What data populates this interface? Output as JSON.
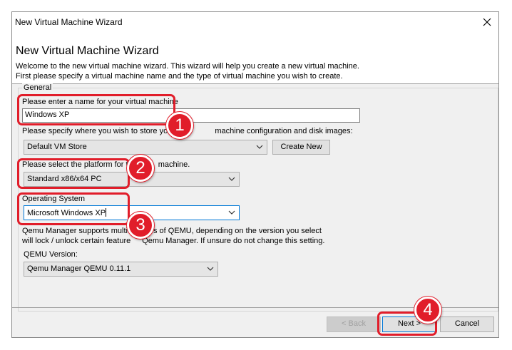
{
  "window": {
    "title": "New Virtual Machine Wizard",
    "close_glyph": "✕"
  },
  "header": {
    "title": "New Virtual Machine Wizard",
    "desc_line1": "Welcome to the new virtual machine wizard.   This wizard will help you create a new virtual machine.",
    "desc_line2": "First please specify a virtual machine name and the type of virtual machine you wish to create."
  },
  "general": {
    "legend": "General",
    "name_label": "Please enter a name for your virtual machine",
    "name_value": "Windows XP",
    "store_label": "Please specify where you wish to store you",
    "store_label_tail": "machine configuration and disk images:",
    "store_value": "Default VM Store",
    "create_new": "Create New",
    "platform_label": "Please select the platform for th",
    "platform_label_tail": "machine.",
    "platform_value": "Standard x86/x64 PC",
    "os_label": "Operating System",
    "os_value": "Microsoft Windows XP",
    "qemu_note_line1_a": "Qemu Manager supports multi",
    "qemu_note_line1_b": "s of QEMU, depending on the version you select",
    "qemu_note_line2_a": "will lock / unlock certain feature",
    "qemu_note_line2_b": "Qemu Manager. If unsure do not change this setting.",
    "qemu_label": "QEMU Version:",
    "qemu_value": "Qemu Manager QEMU 0.11.1"
  },
  "footer": {
    "back": "< Back",
    "next": "Next >",
    "cancel": "Cancel"
  },
  "annotations": {
    "steps": [
      "1",
      "2",
      "3",
      "4"
    ],
    "color": "#e11d2a"
  },
  "icons": {
    "dropdown": "chevron-down-icon",
    "close": "close-icon"
  }
}
